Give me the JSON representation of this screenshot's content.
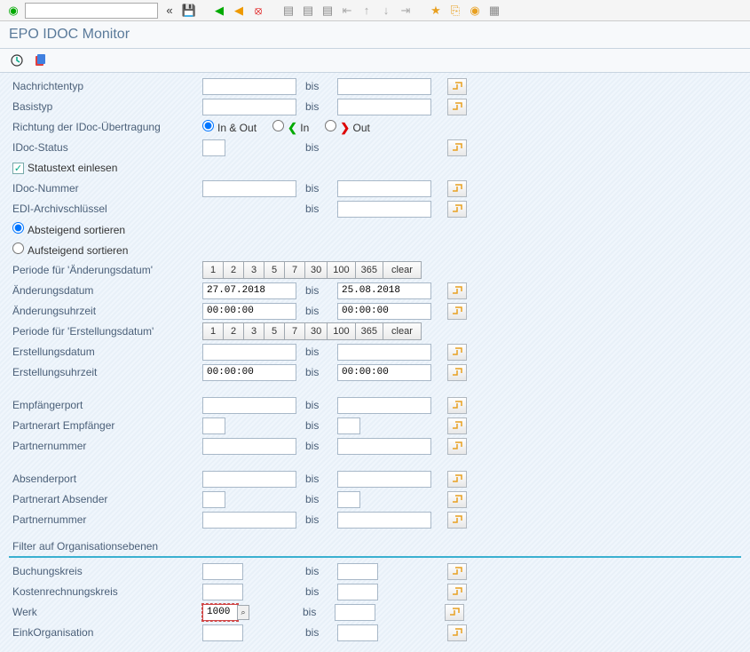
{
  "title": "EPO IDOC Monitor",
  "labels": {
    "nachrichtentyp": "Nachrichtentyp",
    "basistyp": "Basistyp",
    "richtung": "Richtung der IDoc-Übertragung",
    "idoc_status": "IDoc-Status",
    "statustext": "Statustext einlesen",
    "idoc_nummer": "IDoc-Nummer",
    "edi_archiv": "EDI-Archivschlüssel",
    "absteigend": "Absteigend sortieren",
    "aufsteigend": "Aufsteigend sortieren",
    "periode_aenderung": "Periode für 'Änderungsdatum'",
    "aenderungsdatum": "Änderungsdatum",
    "aenderungsuhrzeit": "Änderungsuhrzeit",
    "periode_erstellung": "Periode für 'Erstellungsdatum'",
    "erstellungsdatum": "Erstellungsdatum",
    "erstellungsuhrzeit": "Erstellungsuhrzeit",
    "empfaengerport": "Empfängerport",
    "partnerart_empf": "Partnerart Empfänger",
    "partnernummer1": "Partnernummer",
    "absenderport": "Absenderport",
    "partnerart_abs": "Partnerart Absender",
    "partnernummer2": "Partnernummer",
    "filter_org": "Filter auf Organisationsebenen",
    "buchungskreis": "Buchungskreis",
    "kostenrechnungskreis": "Kostenrechnungskreis",
    "werk": "Werk",
    "einkorganisation": "EinkOrganisation",
    "bis": "bis",
    "in_out": "In & Out",
    "in": "In",
    "out": "Out"
  },
  "values": {
    "aenderungsdatum_from": "27.07.2018",
    "aenderungsdatum_to": "25.08.2018",
    "aenderungsuhrzeit_from": "00:00:00",
    "aenderungsuhrzeit_to": "00:00:00",
    "erstellungsuhrzeit_from": "00:00:00",
    "erstellungsuhrzeit_to": "00:00:00",
    "werk_from": "1000"
  },
  "period_buttons": [
    "1",
    "2",
    "3",
    "5",
    "7",
    "30",
    "100",
    "365",
    "clear"
  ]
}
